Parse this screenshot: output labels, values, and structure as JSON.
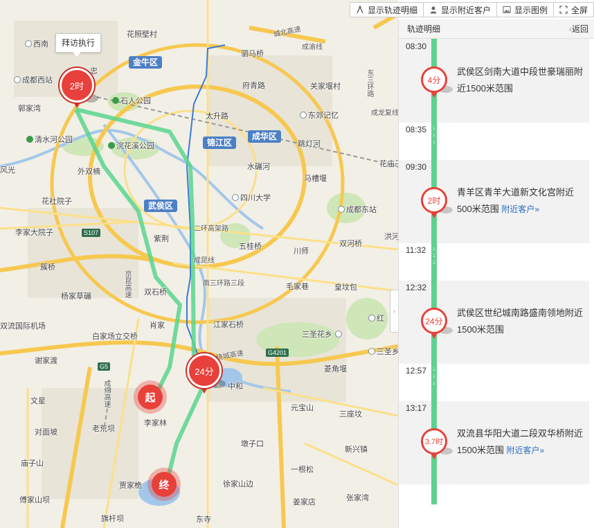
{
  "toolbar": {
    "track_detail": "显示轨迹明细",
    "nearby_customers": "显示附近客户",
    "legend": "显示图例",
    "fullscreen": "全屏"
  },
  "panel": {
    "title": "轨迹明细",
    "back": "返回"
  },
  "timeline": {
    "entries": [
      {
        "time": "08:30",
        "duration": "4分",
        "text": "武侯区剑南大道中段世豪瑞丽附近1500米范围",
        "link": ""
      },
      {
        "time": "08:35",
        "gap": true
      },
      {
        "time": "09:30",
        "duration": "2时",
        "text": "青羊区青羊大道新文化宫附近500米范围",
        "link": "附近客户»"
      },
      {
        "time": "11:32",
        "gap": true
      },
      {
        "time": "12:32",
        "duration": "24分",
        "text": "武侯区世纪城南路盛南领地附近1500米范围",
        "link": ""
      },
      {
        "time": "12:57",
        "gap": true
      },
      {
        "time": "13:17",
        "duration": "3.7时",
        "text": "双流县华阳大道二段双华桥附近1500米范围",
        "link": "附近客户»"
      }
    ]
  },
  "map": {
    "tooltip": "拜访执行",
    "pins": [
      {
        "label": "2时"
      },
      {
        "label": "24分"
      }
    ],
    "start_label": "起",
    "end_label": "终",
    "districts": [
      "金牛区",
      "锦江区",
      "成华区",
      "武侯区"
    ],
    "places": {
      "huazhaobicun": "花照壁村",
      "xinan": "西南",
      "chengduxizhan": "成都西站",
      "zhongsi": "忠",
      "shirengongyuan": "石人公园",
      "jiajiawan": "郭家湾",
      "qingshuihe": "清水河公园",
      "huanhuaxi": "浣花溪公园",
      "waishuangnan": "外双楠",
      "fengguang": "风光",
      "huayuanzi": "花社院子",
      "lijiadayuanzi": "李家大院子",
      "lianqiao": "簇桥",
      "yangjiacaoqiao": "杨家草碾",
      "shuangliu_airport": "双流国际机场",
      "baijiachang": "白家场立交桥",
      "xiejiadu": "谢家渡",
      "wenxing": "文星",
      "duimianpo": "对面坡",
      "miaoziShan": "庙子山",
      "chuanjia": "傅家山坝",
      "qiganba": "旗杆坝",
      "laohuangqiao": "老荒坝",
      "lijialin": "李家林",
      "jiajiaqiao": "贾家桅",
      "shuangshiqiao": "双石桥",
      "xiaoao": "肖家",
      "simaqiao": "驷马桥",
      "fuqinglu": "府青路",
      "guanjiagu": "关家堰村",
      "taishenglu": "太升路",
      "dongjiaoji": "东郊记忆",
      "tiaodenghe": "跳灯河",
      "shuinianhe": "水碾河",
      "majiaqiao": "马槽堰",
      "sichuandaxue": "四川大学",
      "chengdudongzhan": "成都东站",
      "wuguiqiao": "五桂桥",
      "chuanshi": "川师",
      "shuanghezhen": "双河桥",
      "hongshan": "洪河",
      "zijing": "紫荆",
      "jiangjia": "江家石桥",
      "sanshenghua": "三圣花乡",
      "sansheng": "三圣乡",
      "maojiaxiang": "毛家巷",
      "huangjiaobao": "皇坟包",
      "hongxi": "红",
      "lingjiao": "菱角堰",
      "zhonghe": "中和",
      "yuanbaoshan": "元宝山",
      "sanzuoshan": "三座坟",
      "xinxingzhen": "新兴镇",
      "ziguankou": "墩子口",
      "yigenshan": "一根松",
      "xujiashanbian": "徐家山边",
      "jiangjiamiao": "姜家店",
      "zhangjiaying": "张家湾",
      "dongsi": "东寺",
      "huamiaobao": "花庙子"
    },
    "roads": {
      "chengbeigaosu": "城北高速",
      "chengyuxian": "成渝线",
      "erhuangaojia": "二环高架路",
      "sanhuan": "南三环路三段",
      "chengyudongxian": "成昆线",
      "jingkundong": "京昆高速",
      "raocheng": "绕城高速",
      "chengmian": "成绵高速",
      "dongsanhuan": "东三环路",
      "chenglongfuxian": "成龙复线"
    },
    "shields": [
      "S107",
      "G5",
      "G4201"
    ]
  }
}
